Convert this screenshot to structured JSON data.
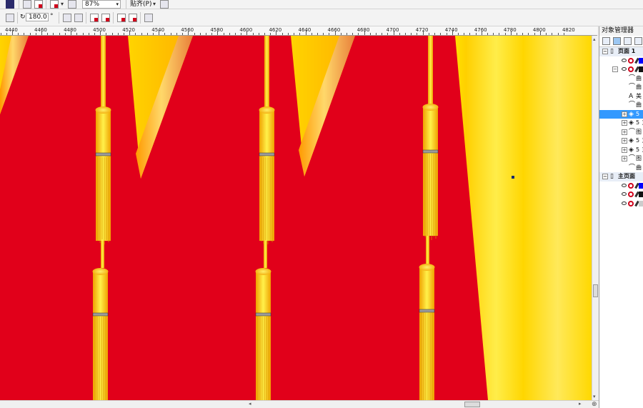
{
  "toolbar": {
    "zoom_value": "87%",
    "snap_label": "贴齐(P)",
    "rotation_value": "180.0",
    "rotation_unit": "°"
  },
  "ruler": {
    "labels": [
      "4440",
      "4460",
      "4480",
      "4500",
      "4520",
      "4540",
      "4560",
      "4580",
      "4600",
      "4620",
      "4640",
      "4660",
      "4680",
      "4700",
      "4720",
      "4740",
      "4760",
      "4780",
      "4800",
      "4820"
    ]
  },
  "object_manager": {
    "title": "对象管理器",
    "rows": [
      {
        "kind": "page",
        "expand": "⊟",
        "text": "页面 1"
      },
      {
        "kind": "layer",
        "indent": 3,
        "swatch": "#0000ff"
      },
      {
        "kind": "layer-open",
        "indent": 2,
        "expand": "⊟",
        "swatch": "#111111"
      },
      {
        "kind": "item",
        "icon": "curve-icon",
        "sym": "⌒",
        "text": "曲"
      },
      {
        "kind": "item",
        "icon": "curve-icon",
        "sym": "⌒",
        "text": "曲"
      },
      {
        "kind": "item",
        "icon": "text-icon",
        "sym": "A",
        "text": "美"
      },
      {
        "kind": "item",
        "icon": "curve-icon",
        "sym": "⌒",
        "text": "曲"
      },
      {
        "kind": "group",
        "expand": "⊞",
        "sym": "◈",
        "text": "5",
        "selected": true
      },
      {
        "kind": "group",
        "expand": "⊞",
        "sym": "◈",
        "text": "5 ヌ"
      },
      {
        "kind": "group",
        "expand": "⊞",
        "sym": "⌒",
        "text": "图"
      },
      {
        "kind": "group",
        "expand": "⊞",
        "sym": "◈",
        "text": "5 ヌ"
      },
      {
        "kind": "group",
        "expand": "⊞",
        "sym": "◈",
        "text": "5 ヌ"
      },
      {
        "kind": "group",
        "expand": "⊞",
        "sym": "⌒",
        "text": "图"
      },
      {
        "kind": "item",
        "icon": "curve-icon",
        "sym": "⌒",
        "text": "曲"
      },
      {
        "kind": "page",
        "expand": "⊟",
        "text": "主页面"
      },
      {
        "kind": "layer",
        "indent": 3,
        "swatch": "#0000ff"
      },
      {
        "kind": "layer",
        "indent": 3,
        "swatch": "#111111"
      },
      {
        "kind": "layer",
        "indent": 3,
        "swatch": "#cccccc"
      }
    ]
  },
  "colors": {
    "background_red": "#e1001a",
    "gold": "#ffd500",
    "gold_light": "#ffe94d",
    "selection_blue": "#3399ff"
  }
}
